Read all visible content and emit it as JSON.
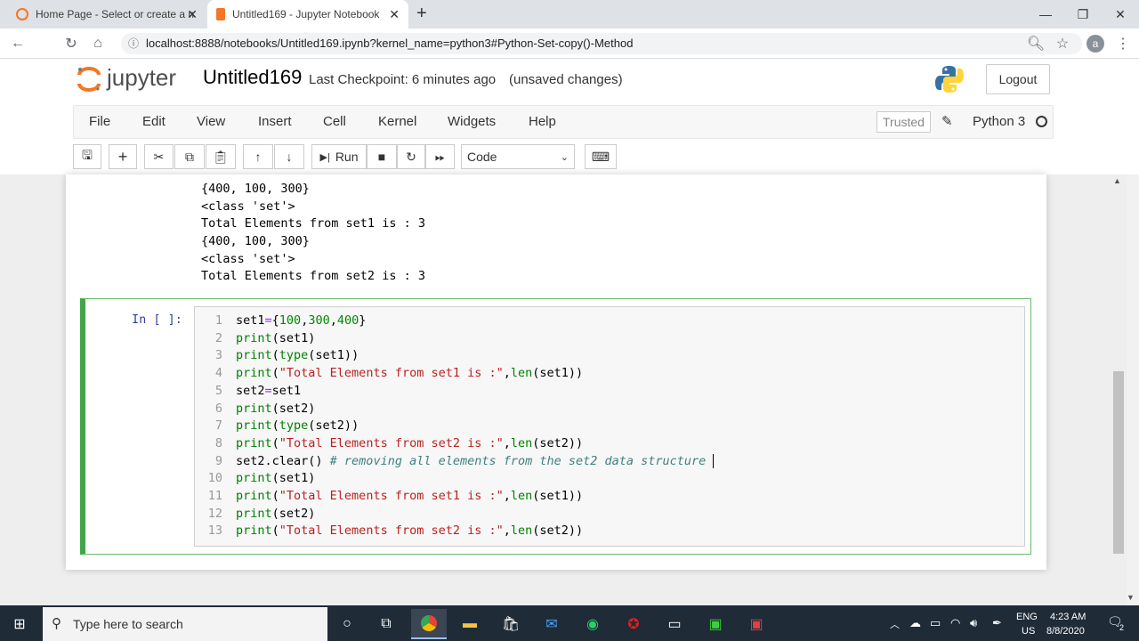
{
  "browser": {
    "tabs": [
      {
        "label": "Home Page - Select or create a n"
      },
      {
        "label": "Untitled169 - Jupyter Notebook"
      }
    ],
    "new_tab": "+",
    "url": "localhost:8888/notebooks/Untitled169.ipynb?kernel_name=python3#Python-Set-copy()-Method",
    "profile_initial": "a"
  },
  "jupyter": {
    "logo_text": "jupyter",
    "notebook_name": "Untitled169",
    "checkpoint": "Last Checkpoint: 6 minutes ago",
    "unsaved": "(unsaved changes)",
    "logout": "Logout",
    "menus": [
      "File",
      "Edit",
      "View",
      "Insert",
      "Cell",
      "Kernel",
      "Widgets",
      "Help"
    ],
    "trusted": "Trusted",
    "kernel": "Python 3",
    "run_label": "Run",
    "cell_type": "Code"
  },
  "output_lines": [
    "{400, 100, 300}",
    "<class 'set'>",
    "Total Elements from set1 is : 3",
    "{400, 100, 300}",
    "<class 'set'>",
    "Total Elements from set2 is : 3"
  ],
  "cell": {
    "prompt": "In [ ]:",
    "line_numbers": [
      "1",
      "2",
      "3",
      "4",
      "5",
      "6",
      "7",
      "8",
      "9",
      "10",
      "11",
      "12",
      "13"
    ]
  },
  "taskbar": {
    "search_placeholder": "Type here to search",
    "lang": "ENG",
    "region": "US",
    "time": "4:23 AM",
    "date": "8/8/2020",
    "notifications": "2"
  },
  "colors": {
    "accent_green": "#42a548",
    "jupyter_orange": "#f37726"
  }
}
